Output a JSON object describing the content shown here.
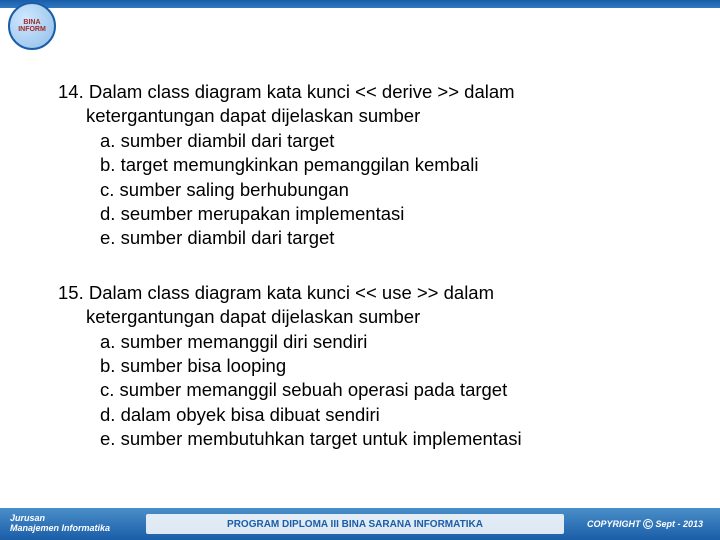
{
  "logo": {
    "line1": "BINA",
    "line2": "INFORM"
  },
  "questions": [
    {
      "number": "14.",
      "stem_line1": "Dalam class diagram kata kunci  << derive  >> dalam",
      "stem_line2": "ketergantungan dapat dijelaskan sumber",
      "options": [
        "a. sumber diambil dari target",
        "b. target memungkinkan pemanggilan kembali",
        "c. sumber saling berhubungan",
        "d. seumber merupakan implementasi",
        "e. sumber diambil dari target"
      ]
    },
    {
      "number": "15.",
      "stem_line1": "Dalam class diagram kata kunci  << use >> dalam",
      "stem_line2": "ketergantungan dapat dijelaskan sumber",
      "options": [
        "a. sumber memanggil diri sendiri",
        "b. sumber bisa looping",
        "c. sumber memanggil sebuah operasi pada target",
        "d. dalam obyek bisa dibuat sendiri",
        "e. sumber membutuhkan target untuk implementasi"
      ]
    }
  ],
  "footer": {
    "dept_line1": "Jurusan",
    "dept_line2": "Manajemen Informatika",
    "program": "PROGRAM DIPLOMA III BINA SARANA INFORMATIKA",
    "copyright_label": "COPYRIGHT",
    "copyright_date": "Sept - 2013"
  }
}
